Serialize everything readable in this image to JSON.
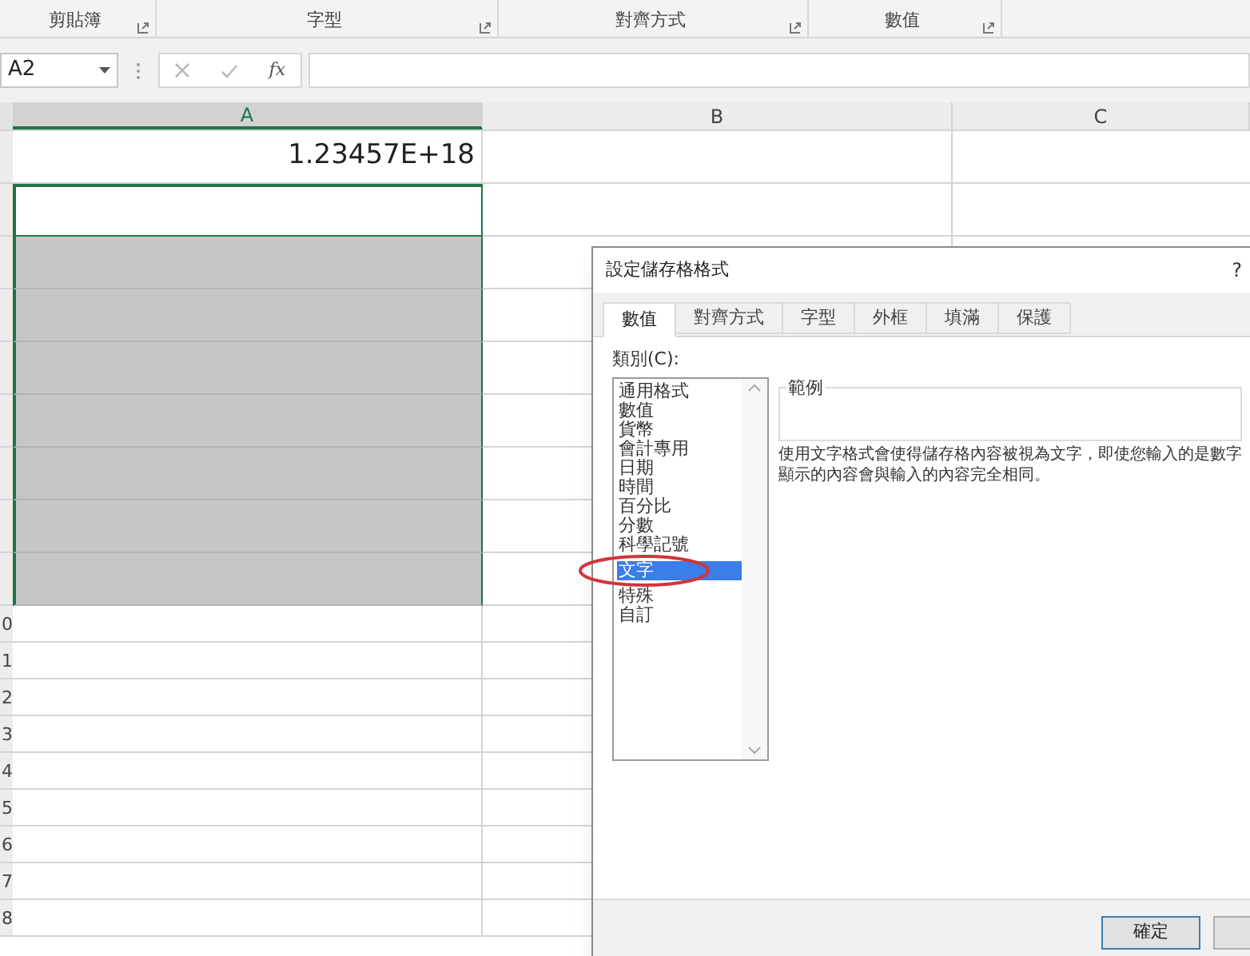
{
  "ribbon_groups": [
    {
      "label": "剪貼簿"
    },
    {
      "label": "字型"
    },
    {
      "label": "對齊方式"
    },
    {
      "label": "數值"
    }
  ],
  "formula_bar": {
    "name_box": "A2",
    "function_label": "fx"
  },
  "columns": [
    {
      "label": "A",
      "selected": true
    },
    {
      "label": "B",
      "selected": false
    },
    {
      "label": "C",
      "selected": false
    }
  ],
  "rows": [
    {
      "value": "1.23457E+18",
      "selected": false,
      "active": false
    },
    {
      "selected": true,
      "active": true
    },
    {
      "selected": true,
      "active": false
    },
    {
      "selected": true,
      "active": false
    },
    {
      "selected": true,
      "active": false
    },
    {
      "selected": true,
      "active": false
    },
    {
      "selected": true,
      "active": false
    },
    {
      "selected": true,
      "active": false
    },
    {
      "selected": true,
      "active": false
    },
    {
      "header": "0",
      "selected": false,
      "active": false
    },
    {
      "header": "1",
      "selected": false,
      "active": false
    },
    {
      "header": "2",
      "selected": false,
      "active": false
    },
    {
      "header": "3",
      "selected": false,
      "active": false
    },
    {
      "header": "4",
      "selected": false,
      "active": false
    },
    {
      "header": "5",
      "selected": false,
      "active": false
    },
    {
      "header": "6",
      "selected": false,
      "active": false
    },
    {
      "header": "7",
      "selected": false,
      "active": false
    },
    {
      "header": "8",
      "selected": false,
      "active": false
    }
  ],
  "dialog": {
    "title": "設定儲存格格式",
    "help": "?",
    "tabs": [
      {
        "label": "數值",
        "selected": true
      },
      {
        "label": "對齊方式",
        "selected": false
      },
      {
        "label": "字型",
        "selected": false
      },
      {
        "label": "外框",
        "selected": false
      },
      {
        "label": "填滿",
        "selected": false
      },
      {
        "label": "保護",
        "selected": false
      }
    ],
    "category_label": "類別(C):",
    "categories": [
      {
        "label": "通用格式",
        "selected": false
      },
      {
        "label": "數值",
        "selected": false
      },
      {
        "label": "貨幣",
        "selected": false
      },
      {
        "label": "會計專用",
        "selected": false
      },
      {
        "label": "日期",
        "selected": false
      },
      {
        "label": "時間",
        "selected": false
      },
      {
        "label": "百分比",
        "selected": false
      },
      {
        "label": "分數",
        "selected": false
      },
      {
        "label": "科學記號",
        "selected": false
      },
      {
        "label": "文字",
        "selected": true
      },
      {
        "label": "特殊",
        "selected": false
      },
      {
        "label": "自訂",
        "selected": false
      }
    ],
    "sample_label": "範例",
    "description": [
      "使用文字格式會使得儲存格內容被視為文字，即使您輸入的是數字",
      "顯示的內容會與輸入的內容完全相同。"
    ],
    "ok_button": "確定"
  }
}
